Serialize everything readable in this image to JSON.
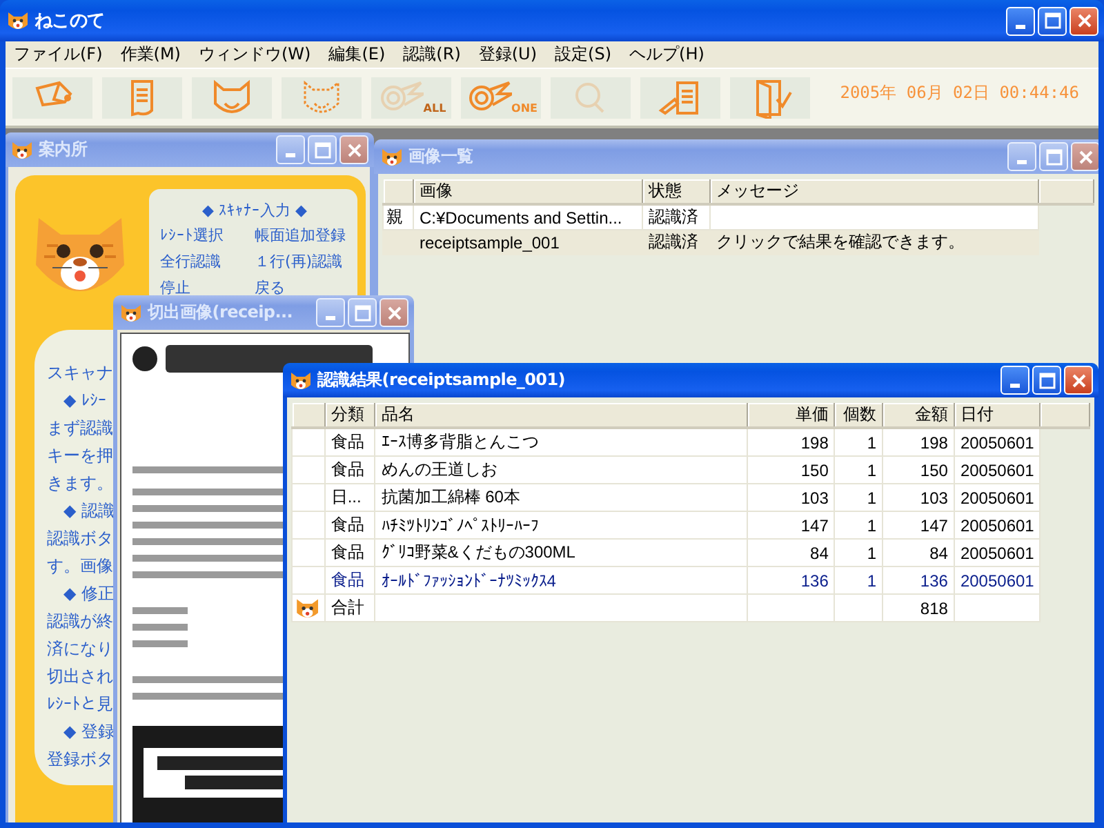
{
  "window": {
    "title": "ねこのて",
    "active": true
  },
  "menu": [
    "ファイル(F)",
    "作業(M)",
    "ウィンドウ(W)",
    "編集(E)",
    "認識(R)",
    "登録(U)",
    "設定(S)",
    "ヘルプ(H)"
  ],
  "toolbar": {
    "buttons": [
      {
        "kind": "pencil",
        "disabled": false
      },
      {
        "kind": "document",
        "disabled": false
      },
      {
        "kind": "cat",
        "disabled": false
      },
      {
        "kind": "cat-dotted",
        "disabled": false
      },
      {
        "kind": "comet",
        "label": "ALL",
        "disabled": true
      },
      {
        "kind": "comet",
        "label": "ONE",
        "disabled": false
      },
      {
        "kind": "magnifier",
        "disabled": true
      },
      {
        "kind": "clipboard",
        "disabled": false
      },
      {
        "kind": "door",
        "disabled": false
      }
    ],
    "datetime": "2005年 06月 02日 00:44:46"
  },
  "windows": [
    {
      "kind": "guide",
      "title": "案内所",
      "active": false,
      "menu_card": {
        "heading": "◆ ｽｷｬﾅｰ入力 ◆",
        "links": [
          "ﾚｼｰﾄ選択",
          "帳面追加登録",
          "全行認識",
          "１行(再)認識",
          "停止",
          "戻る"
        ]
      },
      "help_lines": [
        {
          "kind": "text",
          "text": "スキャナ"
        },
        {
          "kind": "heading",
          "text": "◆ ﾚｼｰ"
        },
        {
          "kind": "text",
          "text": "まず認識"
        },
        {
          "kind": "text",
          "text": "キーを押"
        },
        {
          "kind": "text",
          "text": "きます。"
        },
        {
          "kind": "heading",
          "text": "◆ 認識"
        },
        {
          "kind": "text",
          "text": "認識ボタ"
        },
        {
          "kind": "text",
          "text": "す。画像"
        },
        {
          "kind": "heading",
          "text": "◆ 修正"
        },
        {
          "kind": "text",
          "text": "認識が終"
        },
        {
          "kind": "text",
          "text": "済になり"
        },
        {
          "kind": "text",
          "text": "切出され"
        },
        {
          "kind": "text",
          "text": "ﾚｼｰﾄと見"
        },
        {
          "kind": "heading",
          "text": "◆ 登録"
        },
        {
          "kind": "text",
          "text": "登録ボタ"
        }
      ]
    },
    {
      "kind": "list",
      "title": "画像一覧",
      "active": false,
      "columns": [
        "画像",
        "状態",
        "メッセージ"
      ],
      "rows": [
        {
          "marker": "親",
          "cells": [
            "C:¥Documents and Settin...",
            "認識済"
          ],
          "selected": true
        },
        {
          "cells": [
            "receiptsample_001",
            "認識済",
            "クリックで結果を確認できます。"
          ],
          "selected": false
        }
      ]
    },
    {
      "title": "切出画像(receip...",
      "active": false
    },
    {
      "kind": "results",
      "title": "認識結果(receiptsample_001)",
      "active": true,
      "columns": [
        "分類",
        "品名",
        "単価",
        "個数",
        "金額",
        "日付"
      ],
      "rows": [
        {
          "cells": [
            "食品",
            "ｴｰｽ博多背脂とんこつ",
            "198",
            "1",
            "198",
            "20050601"
          ],
          "selected": false
        },
        {
          "cells": [
            "食品",
            "めんの王道しお",
            "150",
            "1",
            "150",
            "20050601"
          ],
          "selected": false
        },
        {
          "cells": [
            "日...",
            "抗菌加工綿棒 60本",
            "103",
            "1",
            "103",
            "20050601"
          ],
          "selected": false
        },
        {
          "cells": [
            "食品",
            "ﾊﾁﾐﾂﾄﾘﾝｺﾞﾉﾍﾟｽﾄﾘｰﾊｰﾌ",
            "147",
            "1",
            "147",
            "20050601"
          ],
          "selected": false
        },
        {
          "cells": [
            "食品",
            "ｸﾞﾘｺ野菜&くだもの300ML",
            "84",
            "1",
            "84",
            "20050601"
          ],
          "selected": false
        },
        {
          "cells": [
            "食品",
            "ｵｰﾙﾄﾞﾌｧｯｼｮﾝﾄﾞｰﾅﾂﾐｯｸｽ4",
            "136",
            "1",
            "136",
            "20050601"
          ],
          "selected": true
        }
      ],
      "total": {
        "label": "合計",
        "amount": "818"
      }
    }
  ]
}
